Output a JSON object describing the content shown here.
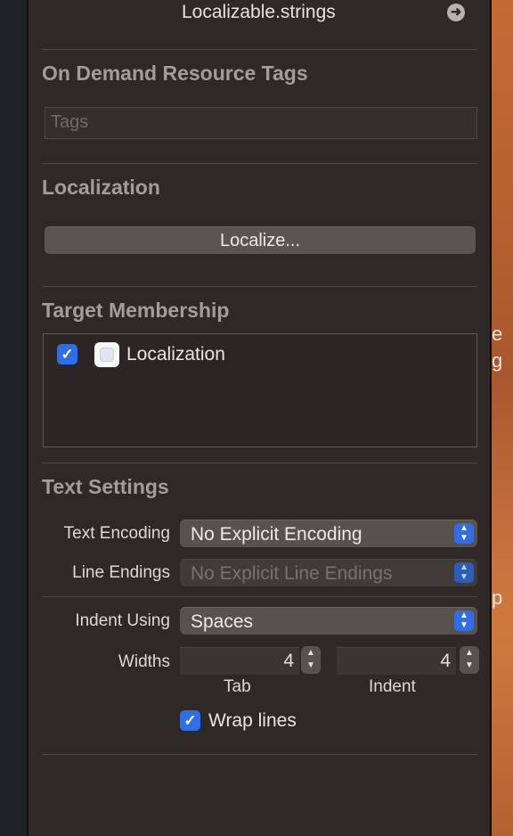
{
  "file": {
    "name": "Localizable.strings",
    "reveal_icon": "arrow-right-circle-icon"
  },
  "on_demand": {
    "title": "On Demand Resource Tags",
    "tags_placeholder": "Tags"
  },
  "localization": {
    "title": "Localization",
    "localize_button": "Localize..."
  },
  "target_membership": {
    "title": "Target Membership",
    "targets": [
      {
        "name": "Localization",
        "checked": true
      }
    ]
  },
  "text_settings": {
    "title": "Text Settings",
    "text_encoding": {
      "label": "Text Encoding",
      "value": "No Explicit Encoding"
    },
    "line_endings": {
      "label": "Line Endings",
      "value": "No Explicit Line Endings",
      "enabled": false
    },
    "indent_using": {
      "label": "Indent Using",
      "value": "Spaces"
    },
    "widths": {
      "label": "Widths",
      "tab_value": "4",
      "indent_value": "4",
      "tab_label": "Tab",
      "indent_label": "Indent"
    },
    "wrap_lines": {
      "label": "Wrap lines",
      "checked": true
    }
  },
  "background_fragments": [
    "e",
    "g",
    "p"
  ],
  "colors": {
    "accent": "#2f6ee6",
    "panel": "#2e2926"
  }
}
